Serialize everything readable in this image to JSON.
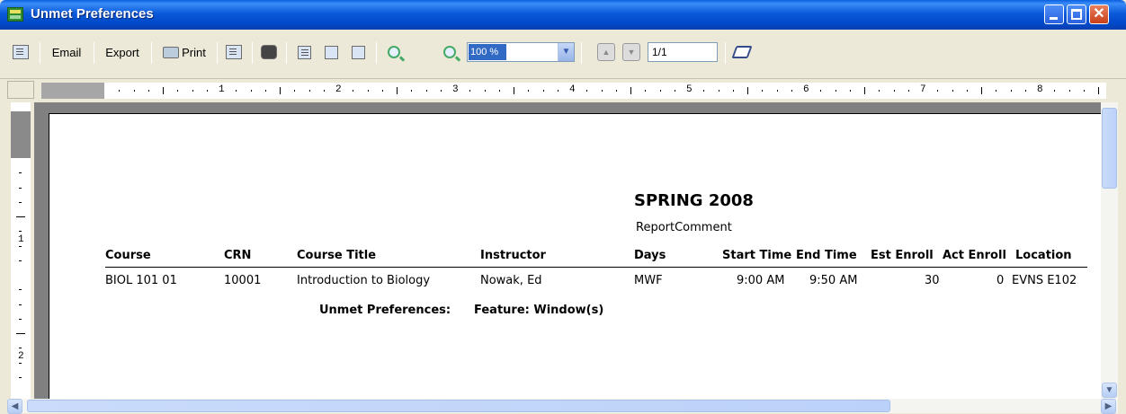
{
  "window": {
    "title": "Unmet Preferences"
  },
  "toolbar": {
    "email_label": "Email",
    "export_label": "Export",
    "print_label": "Print",
    "zoom_value": "100 %",
    "page_value": "1/1"
  },
  "ruler": {
    "h_numbers": [
      "1",
      "2",
      "3",
      "4",
      "5",
      "6",
      "7",
      "8"
    ],
    "v_numbers": [
      "1",
      "2"
    ]
  },
  "report": {
    "term": "SPRING 2008",
    "comment": "ReportComment",
    "headers": {
      "course": "Course",
      "crn": "CRN",
      "course_title": "Course Title",
      "instructor": "Instructor",
      "days": "Days",
      "start_time": "Start Time",
      "end_time": "End Time",
      "est_enroll": "Est Enroll",
      "act_enroll": "Act Enroll",
      "location": "Location"
    },
    "row": {
      "course": "BIOL 101 01",
      "crn": "10001",
      "course_title": "Introduction to Biology",
      "instructor": "Nowak, Ed",
      "days": "MWF",
      "start_time": "9:00 AM",
      "end_time": "9:50 AM",
      "est_enroll": "30",
      "act_enroll": "0",
      "location": "EVNS E102"
    },
    "unmet_label": "Unmet Preferences:",
    "unmet_value": "Feature: Window(s)"
  },
  "colors": {
    "titlebar": "#0b5ada",
    "chrome": "#ece9d8",
    "viewport": "#808080",
    "zoom_highlight": "#316ac5"
  },
  "icons": [
    "copy-icon",
    "binoculars-icon",
    "page-icon",
    "multipage-icon",
    "fit-icon",
    "zoom-out-icon",
    "zoom-in-icon",
    "prev-page-icon",
    "next-page-icon",
    "edit-icon"
  ]
}
